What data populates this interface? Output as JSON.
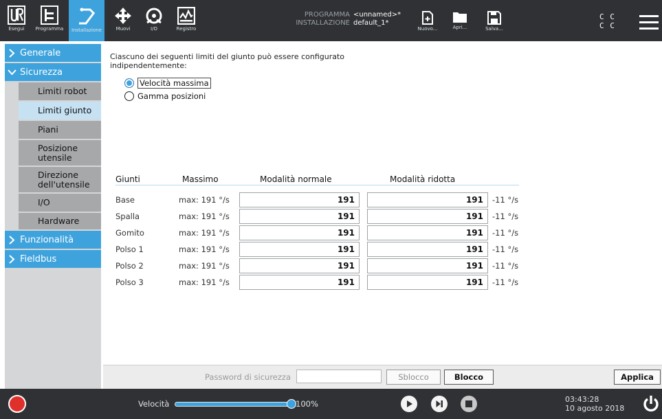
{
  "header": {
    "logo": "UR",
    "tabs": [
      {
        "label": "Esegui",
        "icon": "run-icon"
      },
      {
        "label": "Programma",
        "icon": "program-icon"
      },
      {
        "label": "Installazione",
        "icon": "installation-icon",
        "active": true
      }
    ],
    "nav": [
      {
        "label": "Muovi",
        "icon": "move-icon"
      },
      {
        "label": "I/O",
        "icon": "io-icon"
      },
      {
        "label": "Registro",
        "icon": "log-icon"
      }
    ],
    "program_key": "PROGRAMMA",
    "program_value": "<unnamed>*",
    "installation_key": "INSTALLAZIONE",
    "installation_value": "default_1*",
    "file_buttons": [
      {
        "label": "Nuovo...",
        "icon": "new-file-icon"
      },
      {
        "label": "Apri...",
        "icon": "open-folder-icon"
      },
      {
        "label": "Salva...",
        "icon": "save-icon"
      }
    ],
    "cc_line1": "C C",
    "cc_line2": "C C",
    "accent_color": "#3ea3dd"
  },
  "sidebar": {
    "generale": "Generale",
    "sicurezza": "Sicurezza",
    "items": [
      {
        "label": "Limiti robot"
      },
      {
        "label": "Limiti giunto"
      },
      {
        "label": "Piani"
      },
      {
        "label": "Posizione utensile"
      },
      {
        "label": "Direzione dell'utensile"
      },
      {
        "label": "I/O"
      },
      {
        "label": "Hardware"
      }
    ],
    "active_item": "Limiti giunto",
    "funzionalita": "Funzionalità",
    "fieldbus": "Fieldbus"
  },
  "main": {
    "intro": "Ciascuno dei seguenti limiti del giunto può essere configurato indipendentemente:",
    "radio_speed": "Velocità massima",
    "radio_range": "Gamma posizioni",
    "selected_radio": "Velocità massima",
    "table_headers": {
      "joint": "Giunti",
      "max": "Massimo",
      "normal": "Modalità normale",
      "reduced": "Modalità ridotta"
    },
    "rows": [
      {
        "joint": "Base",
        "max": "max: 191 °/s",
        "normal": "191",
        "reduced": "191",
        "unit": "-11 °/s"
      },
      {
        "joint": "Spalla",
        "max": "max: 191 °/s",
        "normal": "191",
        "reduced": "191",
        "unit": "-11 °/s"
      },
      {
        "joint": "Gomito",
        "max": "max: 191 °/s",
        "normal": "191",
        "reduced": "191",
        "unit": "-11 °/s"
      },
      {
        "joint": "Polso 1",
        "max": "max: 191 °/s",
        "normal": "191",
        "reduced": "191",
        "unit": "-11 °/s"
      },
      {
        "joint": "Polso 2",
        "max": "max: 191 °/s",
        "normal": "191",
        "reduced": "191",
        "unit": "-11 °/s"
      },
      {
        "joint": "Polso 3",
        "max": "max: 191 °/s",
        "normal": "191",
        "reduced": "191",
        "unit": "-11 °/s"
      }
    ]
  },
  "bottom": {
    "password_label": "Password di sicurezza",
    "password_value": "",
    "unlock": "Sblocco",
    "lock": "Blocco",
    "apply": "Applica"
  },
  "footer": {
    "speed_label": "Velocità",
    "speed_value": "100%",
    "speed_fraction": 1.0,
    "time": "03:43:28",
    "date": "10 agosto 2018"
  }
}
